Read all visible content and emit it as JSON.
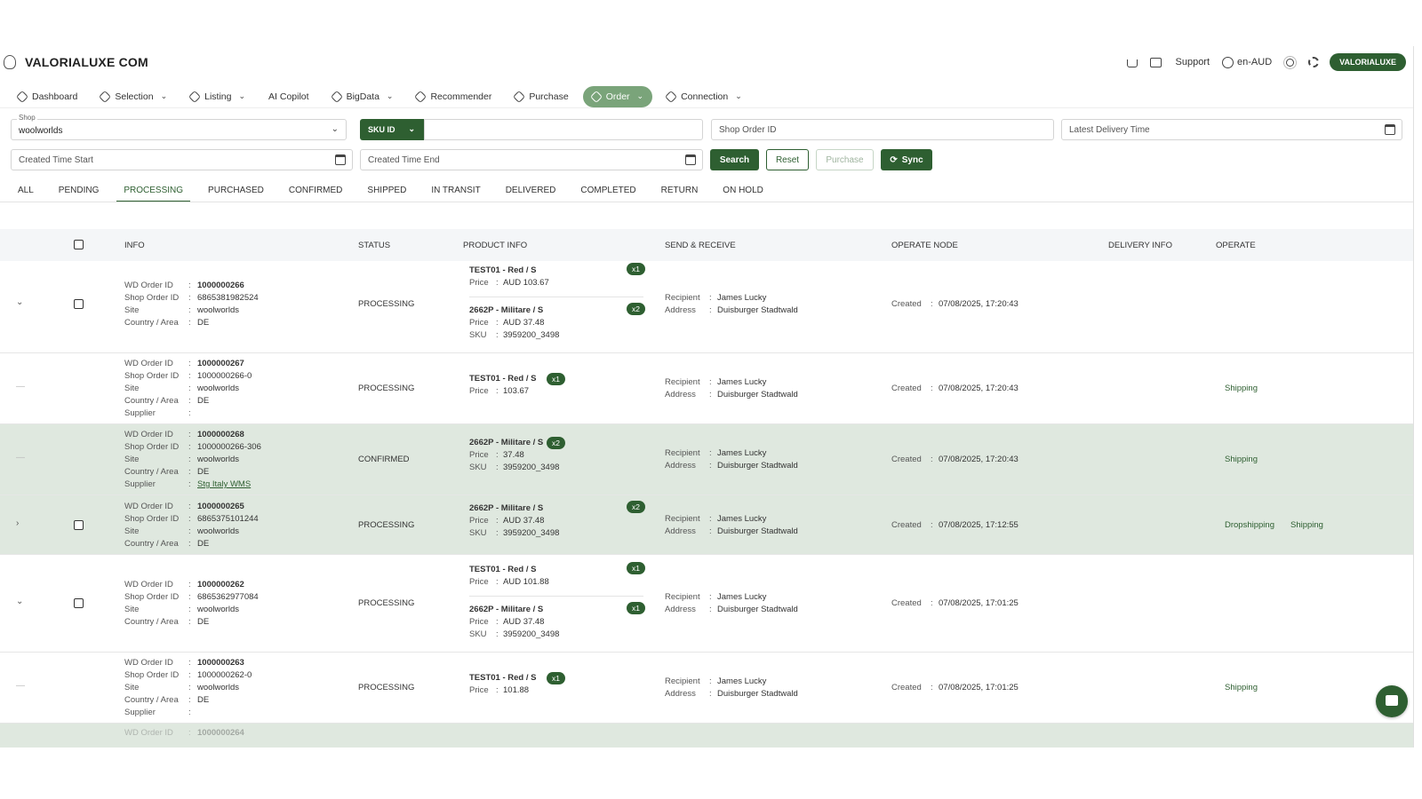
{
  "app": {
    "brand": "VALORIALUXE COM"
  },
  "header": {
    "support": "Support",
    "locale": "en-AUD",
    "user": "VALORIALUXE",
    "icons": [
      "cart-icon",
      "message-icon",
      "globe-icon",
      "theme-icon",
      "settings-icon"
    ]
  },
  "nav": {
    "items": [
      {
        "label": "Dashboard",
        "caret": false,
        "active": false
      },
      {
        "label": "Selection",
        "caret": true,
        "active": false
      },
      {
        "label": "Listing",
        "caret": true,
        "active": false
      },
      {
        "label": "AI Copilot",
        "caret": false,
        "active": false
      },
      {
        "label": "BigData",
        "caret": true,
        "active": false
      },
      {
        "label": "Recommender",
        "caret": false,
        "active": false
      },
      {
        "label": "Purchase",
        "caret": false,
        "active": false
      },
      {
        "label": "Order",
        "caret": true,
        "active": true
      },
      {
        "label": "Connection",
        "caret": true,
        "active": false
      }
    ]
  },
  "filters": {
    "shop_label": "Shop",
    "shop_value": "woolworlds",
    "sku_label": "SKU ID",
    "shop_order_placeholder": "Shop Order ID",
    "delivery_placeholder": "Latest Delivery Time",
    "created_start_placeholder": "Created Time Start",
    "created_end_placeholder": "Created Time End",
    "search": "Search",
    "reset": "Reset",
    "purchase": "Purchase",
    "sync": "Sync"
  },
  "tabs": [
    "ALL",
    "PENDING",
    "PROCESSING",
    "PURCHASED",
    "CONFIRMED",
    "SHIPPED",
    "IN TRANSIT",
    "DELIVERED",
    "COMPLETED",
    "RETURN",
    "ON HOLD"
  ],
  "active_tab": "PROCESSING",
  "table": {
    "headers": {
      "info": "INFO",
      "status": "STATUS",
      "product": "PRODUCT INFO",
      "send": "SEND & RECEIVE",
      "node": "OPERATE NODE",
      "delivery": "DELIVERY INFO",
      "operate": "OPERATE"
    },
    "labels": {
      "wd": "WD Order ID",
      "shop": "Shop Order ID",
      "site": "Site",
      "country": "Country / Area",
      "supplier": "Supplier",
      "price": "Price",
      "sku": "SKU",
      "recipient": "Recipient",
      "address": "Address",
      "created": "Created",
      "colon": ":"
    },
    "rows": [
      {
        "wd": "1000000266",
        "shop": "6865381982524",
        "site": "woolworlds",
        "country": "DE",
        "status": "PROCESSING",
        "recipient": "James Lucky",
        "address": "Duisburger Stadtwald",
        "created": "07/08/2025, 17:20:43",
        "products": [
          {
            "name": "TEST01 - Red / S",
            "price": "AUD 103.67",
            "qty": "x1"
          },
          {
            "name": "2662P - Militare / S",
            "price": "AUD 37.48",
            "sku": "3959200_3498",
            "qty": "x2"
          }
        ],
        "ops": []
      },
      {
        "wd": "1000000267",
        "shop": "1000000266-0",
        "site": "woolworlds",
        "country": "DE",
        "supplier": "",
        "status": "PROCESSING",
        "recipient": "James Lucky",
        "address": "Duisburger Stadtwald",
        "created": "07/08/2025, 17:20:43",
        "products": [
          {
            "name": "TEST01 - Red / S",
            "price": "103.67",
            "qty": "x1"
          }
        ],
        "ops": [
          "Shipping"
        ]
      },
      {
        "wd": "1000000268",
        "shop": "1000000266-306",
        "site": "woolworlds",
        "country": "DE",
        "supplier": "Stg Italy WMS",
        "status": "CONFIRMED",
        "recipient": "James Lucky",
        "address": "Duisburger Stadtwald",
        "created": "07/08/2025, 17:20:43",
        "products": [
          {
            "name": "2662P - Militare / S",
            "price": "37.48",
            "sku": "3959200_3498",
            "qty": "x2"
          }
        ],
        "ops": [
          "Shipping"
        ]
      },
      {
        "wd": "1000000265",
        "shop": "6865375101244",
        "site": "woolworlds",
        "country": "DE",
        "status": "PROCESSING",
        "recipient": "James Lucky",
        "address": "Duisburger Stadtwald",
        "created": "07/08/2025, 17:12:55",
        "products": [
          {
            "name": "2662P - Militare / S",
            "price": "AUD 37.48",
            "sku": "3959200_3498",
            "qty": "x2"
          }
        ],
        "ops": [
          "Dropshipping",
          "Shipping"
        ]
      },
      {
        "wd": "1000000262",
        "shop": "6865362977084",
        "site": "woolworlds",
        "country": "DE",
        "status": "PROCESSING",
        "recipient": "James Lucky",
        "address": "Duisburger Stadtwald",
        "created": "07/08/2025, 17:01:25",
        "products": [
          {
            "name": "TEST01 - Red / S",
            "price": "AUD 101.88",
            "qty": "x1"
          },
          {
            "name": "2662P - Militare / S",
            "price": "AUD 37.48",
            "sku": "3959200_3498",
            "qty": "x1"
          }
        ],
        "ops": []
      },
      {
        "wd": "1000000263",
        "shop": "1000000262-0",
        "site": "woolworlds",
        "country": "DE",
        "supplier": "",
        "status": "PROCESSING",
        "recipient": "James Lucky",
        "address": "Duisburger Stadtwald",
        "created": "07/08/2025, 17:01:25",
        "products": [
          {
            "name": "TEST01 - Red / S",
            "price": "101.88",
            "qty": "x1"
          }
        ],
        "ops": [
          "Shipping"
        ]
      },
      {
        "wd": "1000000264"
      }
    ]
  },
  "colors": {
    "primary": "#2e5f31",
    "highlight": "#dfe8df",
    "nav_active": "#7aa47a"
  }
}
